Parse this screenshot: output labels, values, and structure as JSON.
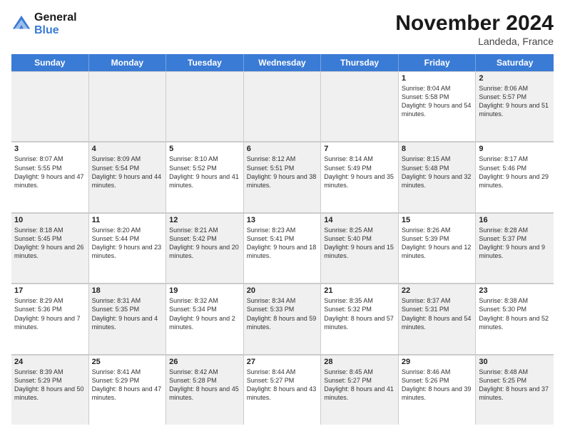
{
  "header": {
    "logo_line1": "General",
    "logo_line2": "Blue",
    "month_title": "November 2024",
    "location": "Landeda, France"
  },
  "days_of_week": [
    "Sunday",
    "Monday",
    "Tuesday",
    "Wednesday",
    "Thursday",
    "Friday",
    "Saturday"
  ],
  "weeks": [
    [
      {
        "day": "",
        "info": "",
        "shaded": true
      },
      {
        "day": "",
        "info": "",
        "shaded": true
      },
      {
        "day": "",
        "info": "",
        "shaded": true
      },
      {
        "day": "",
        "info": "",
        "shaded": true
      },
      {
        "day": "",
        "info": "",
        "shaded": true
      },
      {
        "day": "1",
        "info": "Sunrise: 8:04 AM\nSunset: 5:58 PM\nDaylight: 9 hours and 54 minutes.",
        "shaded": false
      },
      {
        "day": "2",
        "info": "Sunrise: 8:06 AM\nSunset: 5:57 PM\nDaylight: 9 hours and 51 minutes.",
        "shaded": true
      }
    ],
    [
      {
        "day": "3",
        "info": "Sunrise: 8:07 AM\nSunset: 5:55 PM\nDaylight: 9 hours and 47 minutes.",
        "shaded": false
      },
      {
        "day": "4",
        "info": "Sunrise: 8:09 AM\nSunset: 5:54 PM\nDaylight: 9 hours and 44 minutes.",
        "shaded": true
      },
      {
        "day": "5",
        "info": "Sunrise: 8:10 AM\nSunset: 5:52 PM\nDaylight: 9 hours and 41 minutes.",
        "shaded": false
      },
      {
        "day": "6",
        "info": "Sunrise: 8:12 AM\nSunset: 5:51 PM\nDaylight: 9 hours and 38 minutes.",
        "shaded": true
      },
      {
        "day": "7",
        "info": "Sunrise: 8:14 AM\nSunset: 5:49 PM\nDaylight: 9 hours and 35 minutes.",
        "shaded": false
      },
      {
        "day": "8",
        "info": "Sunrise: 8:15 AM\nSunset: 5:48 PM\nDaylight: 9 hours and 32 minutes.",
        "shaded": true
      },
      {
        "day": "9",
        "info": "Sunrise: 8:17 AM\nSunset: 5:46 PM\nDaylight: 9 hours and 29 minutes.",
        "shaded": false
      }
    ],
    [
      {
        "day": "10",
        "info": "Sunrise: 8:18 AM\nSunset: 5:45 PM\nDaylight: 9 hours and 26 minutes.",
        "shaded": true
      },
      {
        "day": "11",
        "info": "Sunrise: 8:20 AM\nSunset: 5:44 PM\nDaylight: 9 hours and 23 minutes.",
        "shaded": false
      },
      {
        "day": "12",
        "info": "Sunrise: 8:21 AM\nSunset: 5:42 PM\nDaylight: 9 hours and 20 minutes.",
        "shaded": true
      },
      {
        "day": "13",
        "info": "Sunrise: 8:23 AM\nSunset: 5:41 PM\nDaylight: 9 hours and 18 minutes.",
        "shaded": false
      },
      {
        "day": "14",
        "info": "Sunrise: 8:25 AM\nSunset: 5:40 PM\nDaylight: 9 hours and 15 minutes.",
        "shaded": true
      },
      {
        "day": "15",
        "info": "Sunrise: 8:26 AM\nSunset: 5:39 PM\nDaylight: 9 hours and 12 minutes.",
        "shaded": false
      },
      {
        "day": "16",
        "info": "Sunrise: 8:28 AM\nSunset: 5:37 PM\nDaylight: 9 hours and 9 minutes.",
        "shaded": true
      }
    ],
    [
      {
        "day": "17",
        "info": "Sunrise: 8:29 AM\nSunset: 5:36 PM\nDaylight: 9 hours and 7 minutes.",
        "shaded": false
      },
      {
        "day": "18",
        "info": "Sunrise: 8:31 AM\nSunset: 5:35 PM\nDaylight: 9 hours and 4 minutes.",
        "shaded": true
      },
      {
        "day": "19",
        "info": "Sunrise: 8:32 AM\nSunset: 5:34 PM\nDaylight: 9 hours and 2 minutes.",
        "shaded": false
      },
      {
        "day": "20",
        "info": "Sunrise: 8:34 AM\nSunset: 5:33 PM\nDaylight: 8 hours and 59 minutes.",
        "shaded": true
      },
      {
        "day": "21",
        "info": "Sunrise: 8:35 AM\nSunset: 5:32 PM\nDaylight: 8 hours and 57 minutes.",
        "shaded": false
      },
      {
        "day": "22",
        "info": "Sunrise: 8:37 AM\nSunset: 5:31 PM\nDaylight: 8 hours and 54 minutes.",
        "shaded": true
      },
      {
        "day": "23",
        "info": "Sunrise: 8:38 AM\nSunset: 5:30 PM\nDaylight: 8 hours and 52 minutes.",
        "shaded": false
      }
    ],
    [
      {
        "day": "24",
        "info": "Sunrise: 8:39 AM\nSunset: 5:29 PM\nDaylight: 8 hours and 50 minutes.",
        "shaded": true
      },
      {
        "day": "25",
        "info": "Sunrise: 8:41 AM\nSunset: 5:29 PM\nDaylight: 8 hours and 47 minutes.",
        "shaded": false
      },
      {
        "day": "26",
        "info": "Sunrise: 8:42 AM\nSunset: 5:28 PM\nDaylight: 8 hours and 45 minutes.",
        "shaded": true
      },
      {
        "day": "27",
        "info": "Sunrise: 8:44 AM\nSunset: 5:27 PM\nDaylight: 8 hours and 43 minutes.",
        "shaded": false
      },
      {
        "day": "28",
        "info": "Sunrise: 8:45 AM\nSunset: 5:27 PM\nDaylight: 8 hours and 41 minutes.",
        "shaded": true
      },
      {
        "day": "29",
        "info": "Sunrise: 8:46 AM\nSunset: 5:26 PM\nDaylight: 8 hours and 39 minutes.",
        "shaded": false
      },
      {
        "day": "30",
        "info": "Sunrise: 8:48 AM\nSunset: 5:25 PM\nDaylight: 8 hours and 37 minutes.",
        "shaded": true
      }
    ]
  ]
}
